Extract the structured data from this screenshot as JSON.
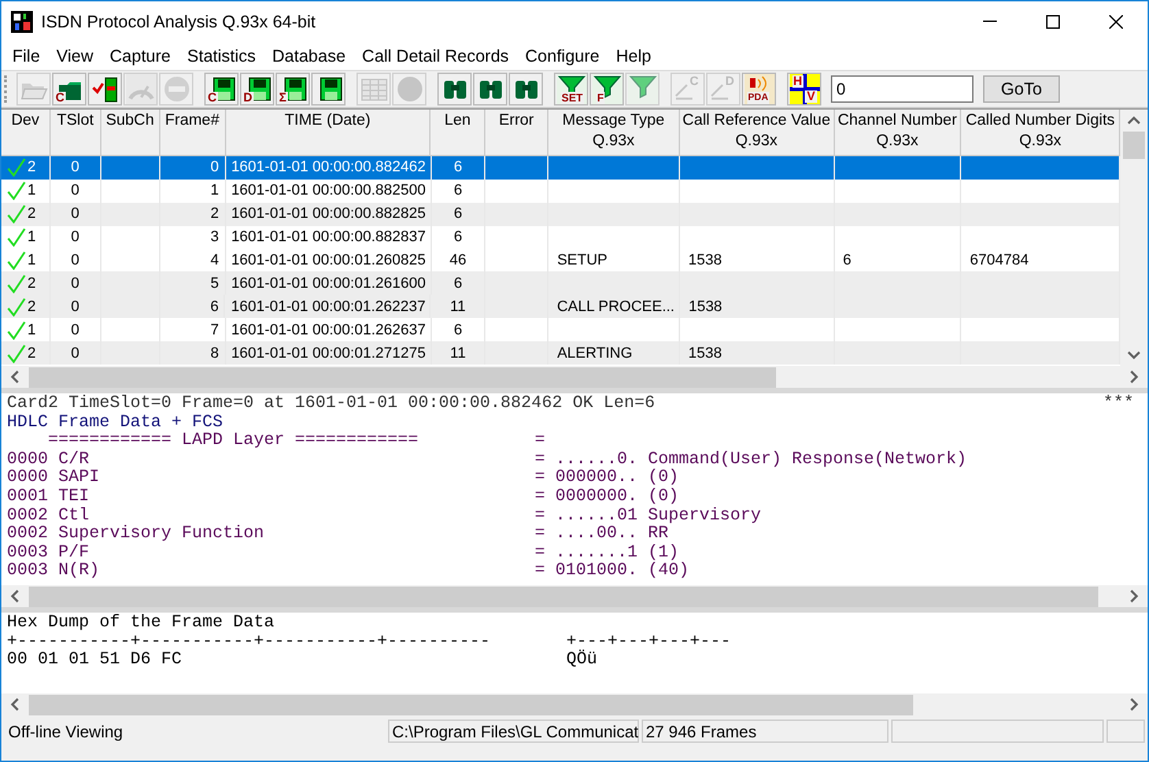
{
  "window": {
    "title": "ISDN Protocol Analysis Q.93x 64-bit"
  },
  "menu": [
    "File",
    "View",
    "Capture",
    "Statistics",
    "Database",
    "Call Detail Records",
    "Configure",
    "Help"
  ],
  "toolbar": [
    {
      "kind": "open",
      "disabled": true
    },
    {
      "kind": "folder",
      "glyph": "C",
      "disabled": false
    },
    {
      "kind": "list",
      "disabled": false
    },
    {
      "kind": "gauge",
      "disabled": true
    },
    {
      "kind": "stop",
      "disabled": true
    },
    {
      "kind": "sep"
    },
    {
      "kind": "disk",
      "glyph": "C",
      "disabled": false
    },
    {
      "kind": "disk",
      "glyph": "D",
      "disabled": false
    },
    {
      "kind": "disk",
      "glyph": "Σ",
      "disabled": false
    },
    {
      "kind": "disk",
      "disabled": false
    },
    {
      "kind": "sep"
    },
    {
      "kind": "grid",
      "disabled": true
    },
    {
      "kind": "circle",
      "disabled": true
    },
    {
      "kind": "sep"
    },
    {
      "kind": "binoculars",
      "disabled": false
    },
    {
      "kind": "binoculars",
      "disabled": false
    },
    {
      "kind": "binoculars",
      "disabled": false
    },
    {
      "kind": "sep"
    },
    {
      "kind": "filter",
      "glyph": "SET",
      "disabled": false
    },
    {
      "kind": "filter",
      "glyph": "F",
      "disabled": false
    },
    {
      "kind": "filter",
      "disabled": true
    },
    {
      "kind": "sep"
    },
    {
      "kind": "letter",
      "glyph": "C",
      "disabled": true
    },
    {
      "kind": "letter",
      "glyph": "D",
      "disabled": true
    },
    {
      "kind": "speaker",
      "glyph": "PDA",
      "disabled": false
    },
    {
      "kind": "sep"
    },
    {
      "kind": "hv",
      "glyph": "H",
      "glyph2": "V",
      "disabled": false
    }
  ],
  "goto": {
    "value": "0",
    "button": "GoTo"
  },
  "table": {
    "columns": [
      {
        "label": "Dev"
      },
      {
        "label": "TSlot"
      },
      {
        "label": "SubCh"
      },
      {
        "label": "Frame#"
      },
      {
        "label": "TIME (Date)"
      },
      {
        "label": "Len"
      },
      {
        "label": "Error"
      },
      {
        "label": "Message Type",
        "sub": "Q.93x"
      },
      {
        "label": "Call Reference Value",
        "sub": "Q.93x"
      },
      {
        "label": "Channel Number",
        "sub": "Q.93x"
      },
      {
        "label": "Called Number Digits",
        "sub": "Q.93x"
      }
    ],
    "rows": [
      {
        "selected": true,
        "shaded": false,
        "cells": [
          "2",
          "0",
          "",
          "0",
          "1601-01-01 00:00:00.882462",
          "6",
          "",
          "",
          "",
          "",
          ""
        ]
      },
      {
        "selected": false,
        "shaded": false,
        "cells": [
          "1",
          "0",
          "",
          "1",
          "1601-01-01 00:00:00.882500",
          "6",
          "",
          "",
          "",
          "",
          ""
        ]
      },
      {
        "selected": false,
        "shaded": true,
        "cells": [
          "2",
          "0",
          "",
          "2",
          "1601-01-01 00:00:00.882825",
          "6",
          "",
          "",
          "",
          "",
          ""
        ]
      },
      {
        "selected": false,
        "shaded": false,
        "cells": [
          "1",
          "0",
          "",
          "3",
          "1601-01-01 00:00:00.882837",
          "6",
          "",
          "",
          "",
          "",
          ""
        ]
      },
      {
        "selected": false,
        "shaded": false,
        "cells": [
          "1",
          "0",
          "",
          "4",
          "1601-01-01 00:00:01.260825",
          "46",
          "",
          "SETUP",
          "1538",
          "6",
          "6704784"
        ]
      },
      {
        "selected": false,
        "shaded": true,
        "cells": [
          "2",
          "0",
          "",
          "5",
          "1601-01-01 00:00:01.261600",
          "6",
          "",
          "",
          "",
          "",
          ""
        ]
      },
      {
        "selected": false,
        "shaded": true,
        "cells": [
          "2",
          "0",
          "",
          "6",
          "1601-01-01 00:00:01.262237",
          "11",
          "",
          "CALL PROCEE...",
          "1538",
          "",
          ""
        ]
      },
      {
        "selected": false,
        "shaded": false,
        "cells": [
          "1",
          "0",
          "",
          "7",
          "1601-01-01 00:00:01.262637",
          "6",
          "",
          "",
          "",
          "",
          ""
        ]
      },
      {
        "selected": false,
        "shaded": true,
        "cells": [
          "2",
          "0",
          "",
          "8",
          "1601-01-01 00:00:01.271275",
          "11",
          "",
          "ALERTING",
          "1538",
          "",
          ""
        ]
      }
    ]
  },
  "detail": {
    "header": "Card2 TimeSlot=0 Frame=0 at 1601-01-01 00:00:00.882462 OK Len=6",
    "marker": "***",
    "title": "HDLC Frame Data + FCS",
    "lines": [
      {
        "label": "    ============ LAPD Layer ============",
        "value": "="
      },
      {
        "label": "0000 C/R",
        "value": "= ......0. Command(User) Response(Network)"
      },
      {
        "label": "0000 SAPI",
        "value": "= 000000.. (0)"
      },
      {
        "label": "0001 TEI",
        "value": "= 0000000. (0)"
      },
      {
        "label": "0002 Ctl",
        "value": "= ......01 Supervisory"
      },
      {
        "label": "0002 Supervisory Function",
        "value": "= ....00.. RR"
      },
      {
        "label": "0003 P/F",
        "value": "= .......1 (1)"
      },
      {
        "label": "0003 N(R)",
        "value": "= 0101000. (40)"
      }
    ]
  },
  "hex": {
    "title": "Hex Dump of the Frame Data",
    "lines": [
      {
        "hex": "+-----------+-----------+-----------+----------",
        "ascii": "+---+---+---+---"
      },
      {
        "hex": "00 01 01 51 D6 FC",
        "ascii": "QÖü"
      }
    ]
  },
  "status_bar": [
    "Off-line Viewing",
    "C:\\Program Files\\GL Communicat",
    "27 946 Frames"
  ]
}
